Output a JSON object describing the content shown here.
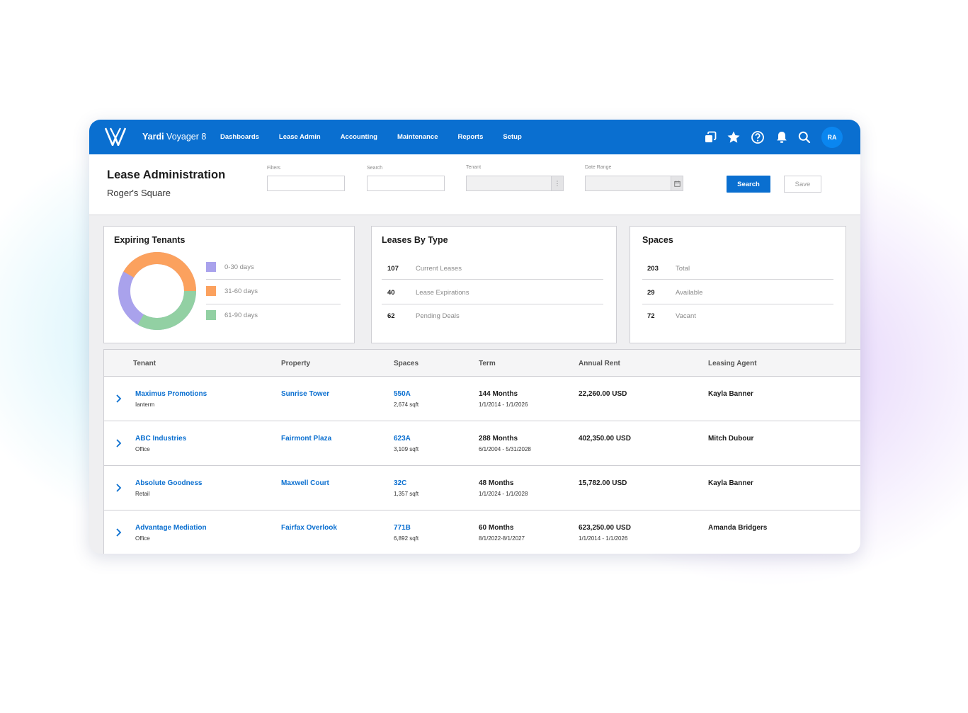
{
  "app": {
    "brand_bold": "Yardi",
    "brand_rest": " Voyager 8",
    "avatar": "RA"
  },
  "nav": [
    "Dashboards",
    "Lease Admin",
    "Accounting",
    "Maintenance",
    "Reports",
    "Setup"
  ],
  "toolbar_icons": [
    "windows-icon",
    "star-icon",
    "help-icon",
    "bell-icon",
    "search-icon"
  ],
  "header": {
    "title": "Lease Administration",
    "subtitle": "Roger's Square",
    "filters_label": "Filters",
    "search_label": "Search",
    "tenant_label": "Tenant",
    "date_range_label": "Date Range",
    "search_button": "Search",
    "save_button": "Save"
  },
  "colors": {
    "primary": "#0a6fd0",
    "donut_0_30": "#a9a2ec",
    "donut_31_60": "#fba15e",
    "donut_61_90": "#92d0a3"
  },
  "expiring": {
    "title": "Expiring Tenants",
    "legend": [
      "0-30 days",
      "31-60 days",
      "61-90 days"
    ]
  },
  "leases_by_type": {
    "title": "Leases By Type",
    "rows": [
      {
        "num": "107",
        "label": "Current Leases"
      },
      {
        "num": "40",
        "label": "Lease Expirations"
      },
      {
        "num": "62",
        "label": "Pending Deals"
      }
    ]
  },
  "spaces": {
    "title": "Spaces",
    "rows": [
      {
        "num": "203",
        "label": "Total"
      },
      {
        "num": "29",
        "label": "Available"
      },
      {
        "num": "72",
        "label": "Vacant"
      }
    ]
  },
  "table": {
    "columns": [
      "Tenant",
      "Property",
      "Spaces",
      "Term",
      "Annual Rent",
      "Leasing Agent"
    ],
    "rows": [
      {
        "tenant": "Maximus Promotions",
        "tenant_type": "Ianterm",
        "property": "Sunrise Tower",
        "space": "550A",
        "sqft": "2,674 sqft",
        "term": "144 Months",
        "term_dates": "1/1/2014 - 1/1/2026",
        "rent": "22,260.00 USD",
        "rent_dates": "",
        "agent": "Kayla Banner"
      },
      {
        "tenant": "ABC Industries",
        "tenant_type": "Office",
        "property": "Fairmont Plaza",
        "space": "623A",
        "sqft": "3,109 sqft",
        "term": "288 Months",
        "term_dates": "6/1/2004 - 5/31/2028",
        "rent": "402,350.00 USD",
        "rent_dates": "",
        "agent": "Mitch Dubour"
      },
      {
        "tenant": "Absolute Goodness",
        "tenant_type": "Retail",
        "property": "Maxwell Court",
        "space": "32C",
        "sqft": "1,357 sqft",
        "term": "48 Months",
        "term_dates": "1/1/2024 - 1/1/2028",
        "rent": "15,782.00 USD",
        "rent_dates": "",
        "agent": "Kayla Banner"
      },
      {
        "tenant": "Advantage Mediation",
        "tenant_type": "Office",
        "property": "Fairfax Overlook",
        "space": "771B",
        "sqft": "6,892 sqft",
        "term": "60 Months",
        "term_dates": "8/1/2022-8/1/2027",
        "rent": "623,250.00 USD",
        "rent_dates": "1/1/2014 - 1/1/2026",
        "agent": "Amanda Bridgers"
      }
    ]
  }
}
